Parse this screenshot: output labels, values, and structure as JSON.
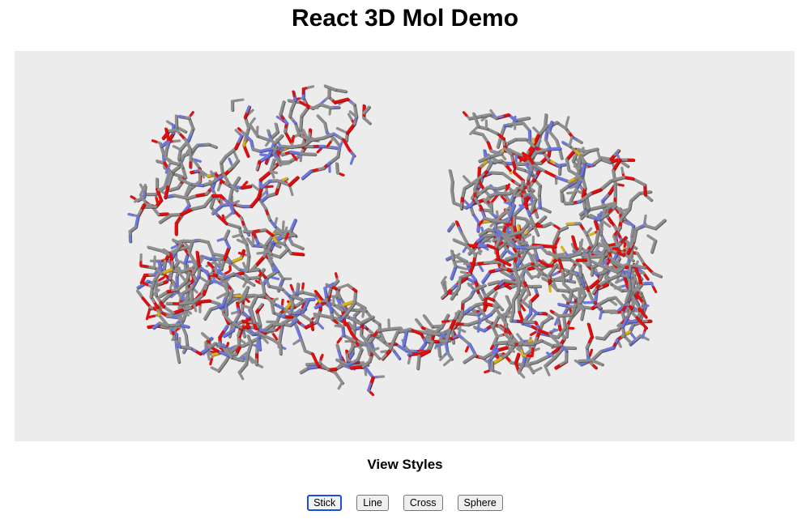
{
  "page": {
    "title": "React 3D Mol Demo"
  },
  "viewer": {
    "style": "stick",
    "atom_colors": {
      "carbon": "#8f8f8f",
      "oxygen": "#e01010",
      "nitrogen": "#6e78d8",
      "sulfur": "#d8b020",
      "background": "#ececec"
    }
  },
  "controls": {
    "heading": "View Styles",
    "buttons": [
      {
        "label": "Stick",
        "active": true
      },
      {
        "label": "Line",
        "active": false
      },
      {
        "label": "Cross",
        "active": false
      },
      {
        "label": "Sphere",
        "active": false
      }
    ]
  }
}
